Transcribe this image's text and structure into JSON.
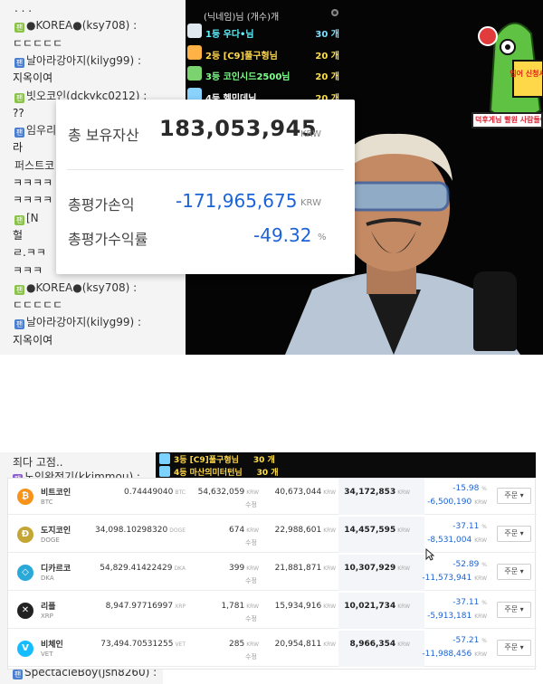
{
  "top": {
    "chat_lines": [
      {
        "text": ". . ."
      },
      {
        "badge": "팬",
        "badge_color": "green",
        "text": "●KOREA●(ksy708) :"
      },
      {
        "text": "ㄷㄷㄷㄷㄷ",
        "msg": true
      },
      {
        "badge": "팬",
        "badge_color": "blue",
        "text": "날아라강아지(kilyg99) :"
      },
      {
        "text": "지옥이여",
        "msg": true
      },
      {
        "badge": "팬",
        "badge_color": "green",
        "text": "빗오코인(dckykc0212) :"
      },
      {
        "text": "??",
        "msg": true
      },
      {
        "badge": "팬",
        "badge_color": "blue",
        "text": "임우리"
      },
      {
        "text": "라",
        "msg": true
      },
      {
        "text": "퍼스트코"
      },
      {
        "text": "ㅋㅋㅋㅋ",
        "msg": true
      },
      {
        "text": "ㅋㅋㅋㅋ",
        "msg": true
      },
      {
        "badge": "팬",
        "badge_color": "green",
        "text": "[N"
      },
      {
        "text": "헐",
        "msg": true
      },
      {
        "text": "ㄹ.ㅋㅋ",
        "msg": true
      },
      {
        "text": "ㅋㅋㅋ",
        "msg": true
      },
      {
        "badge": "팬",
        "badge_color": "green",
        "text": "●KOREA●(ksy708) :"
      },
      {
        "text": "ㄷㄷㄷㄷㄷ",
        "msg": true
      },
      {
        "badge": "팬",
        "badge_color": "blue",
        "text": "날아라강아지(kilyg99) :"
      },
      {
        "text": "지옥이여",
        "msg": true
      }
    ],
    "donor_title": "(닉네임)님 (개수)개",
    "donors": [
      {
        "rank": "1등 우다•님",
        "count": "30 개",
        "color": "cyan"
      },
      {
        "rank": "2등 [C9]풀구형님",
        "count": "20 개",
        "color": "yellow"
      },
      {
        "rank": "3등 코인시드2500님",
        "count": "20 개",
        "color": "green"
      },
      {
        "rank": "4등 헬민데님",
        "count": "20 개",
        "color": "white"
      }
    ],
    "mascot_text": "덕후게님 빨원 사람들이 미스터 스태킹 무엉증이",
    "mascot_sign": "입어 신청서",
    "asset": {
      "total_label": "총 보유자산",
      "total_value": "183,053,945",
      "total_unit": "KRW",
      "pl_label": "총평가손익",
      "pl_value": "-171,965,675",
      "pl_unit": "KRW",
      "rate_label": "총평가수익률",
      "rate_value": "-49.32",
      "rate_unit": "%"
    }
  },
  "bottom": {
    "chat_lines": [
      {
        "text": "죄다 고점.."
      },
      {
        "badge": "팬",
        "badge_color": "purple",
        "text": "노인완전기(kkimmou) :"
      }
    ],
    "chat_bottom": "SpectacleBoy(jsh8260) :",
    "strip": [
      {
        "name": "3등 [C9]풀구형님",
        "count": "30 개"
      },
      {
        "name": "4등 마산의미터턴님",
        "count": "30 개"
      }
    ],
    "coins": [
      {
        "name": "비트코인",
        "sym": "BTC",
        "qty": "0.74449040",
        "avg": "54,632,059",
        "buy": "40,673,044",
        "eval": "34,172,853",
        "rate": "-15.98",
        "pl": "-6,500,190",
        "logo_color": "#f7931a",
        "logo_char": "₿"
      },
      {
        "name": "도지코인",
        "sym": "DOGE",
        "qty": "34,098.10298320",
        "avg": "674",
        "buy": "22,988,601",
        "eval": "14,457,595",
        "rate": "-37.11",
        "pl": "-8,531,004",
        "logo_color": "#c3a634",
        "logo_char": "Ð"
      },
      {
        "name": "디카르코",
        "sym": "DKA",
        "qty": "54,829.41422429",
        "avg": "399",
        "buy": "21,881,871",
        "eval": "10,307,929",
        "rate": "-52.89",
        "pl": "-11,573,941",
        "logo_color": "#2aa8d8",
        "logo_char": "◇"
      },
      {
        "name": "리플",
        "sym": "XRP",
        "qty": "8,947.97716997",
        "avg": "1,781",
        "buy": "15,934,916",
        "eval": "10,021,734",
        "rate": "-37.11",
        "pl": "-5,913,181",
        "logo_color": "#222222",
        "logo_char": "✕"
      },
      {
        "name": "비체인",
        "sym": "VET",
        "qty": "73,494.70531255",
        "avg": "285",
        "buy": "20,954,811",
        "eval": "8,966,354",
        "rate": "-57.21",
        "pl": "-11,988,456",
        "logo_color": "#15bdff",
        "logo_char": "V"
      }
    ],
    "units": {
      "krw": "KRW",
      "pct": "%",
      "fix": "수정"
    },
    "order_label": "주문 ▾"
  }
}
